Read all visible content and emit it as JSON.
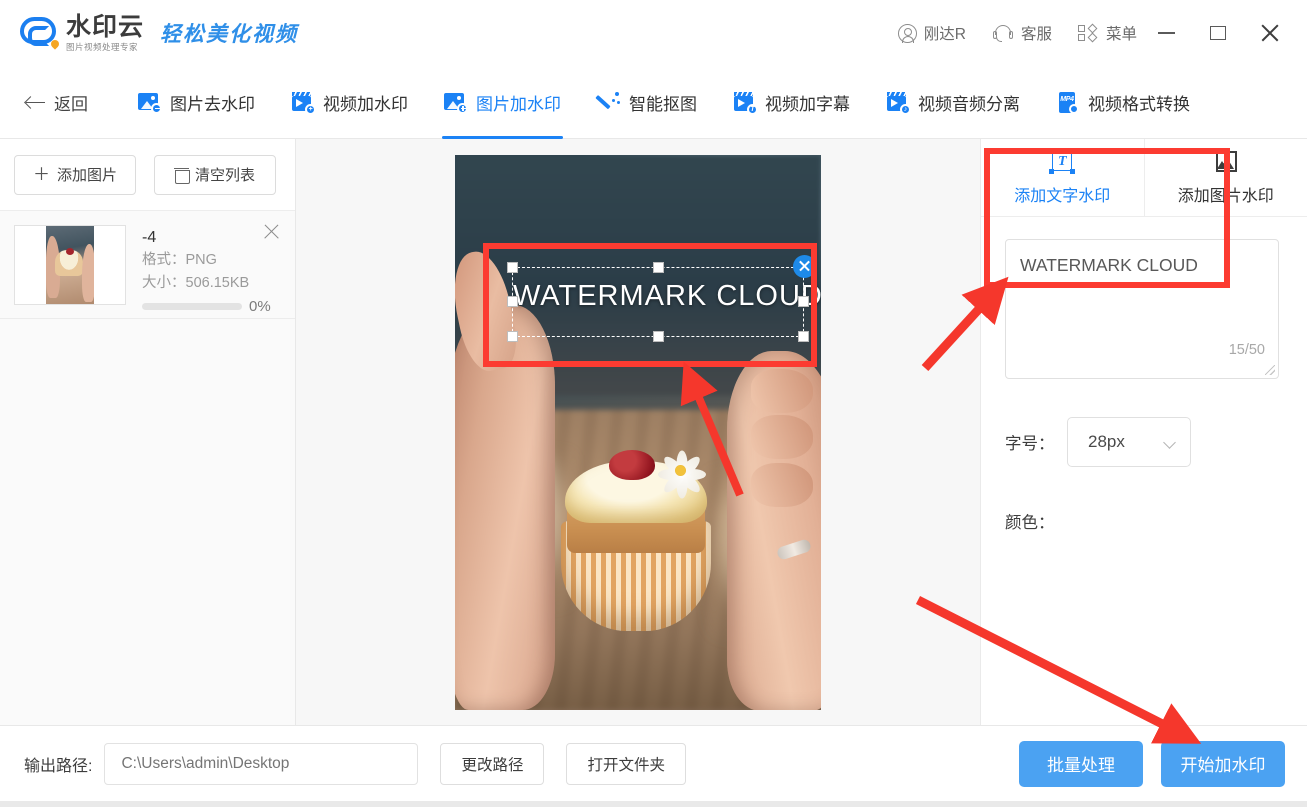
{
  "titlebar": {
    "brand_name": "水印云",
    "brand_sub": "图片视频处理专家",
    "slogan": "轻松美化视频",
    "account": "刚达R",
    "support": "客服",
    "menu": "菜单",
    "minimize_icon": "minimize-icon",
    "maximize_icon": "maximize-icon",
    "close_icon": "close-icon"
  },
  "nav": {
    "back_label": "返回",
    "tabs": [
      {
        "label": "图片去水印",
        "icon": "image-remove-watermark-icon",
        "active": false
      },
      {
        "label": "视频加水印",
        "icon": "video-add-watermark-icon",
        "active": false
      },
      {
        "label": "图片加水印",
        "icon": "image-add-watermark-icon",
        "active": true
      },
      {
        "label": "智能抠图",
        "icon": "magic-wand-icon",
        "active": false
      },
      {
        "label": "视频加字幕",
        "icon": "video-subtitle-icon",
        "active": false
      },
      {
        "label": "视频音频分离",
        "icon": "video-audio-split-icon",
        "active": false
      },
      {
        "label": "视频格式转换",
        "icon": "mp4-convert-icon",
        "active": false
      }
    ]
  },
  "left_panel": {
    "add_images_label": "添加图片",
    "clear_list_label": "清空列表",
    "file": {
      "name": "-4",
      "format_label": "格式：",
      "format_value": "PNG",
      "size_label": "大小：",
      "size_value": "506.15KB",
      "progress_text": "0%",
      "progress_percent": 0
    }
  },
  "canvas": {
    "watermark_text": "WATERMARK CLOUD",
    "watermark_font_size_px": 28,
    "watermark_color": "#ffffff"
  },
  "right_panel": {
    "tabs": [
      {
        "label": "添加文字水印",
        "icon": "text-watermark-icon",
        "active": true
      },
      {
        "label": "添加图片水印",
        "icon": "image-watermark-icon",
        "active": false
      }
    ],
    "textarea_value": "WATERMARK CLOUD",
    "char_counter": "15/50",
    "font_size_label": "字号：",
    "font_size_value": "28px",
    "color_label": "颜色："
  },
  "bottom_bar": {
    "output_label": "输出路径:",
    "output_path": "C:\\Users\\admin\\Desktop",
    "change_path_label": "更改路径",
    "open_folder_label": "打开文件夹",
    "batch_label": "批量处理",
    "start_label": "开始加水印"
  },
  "colors": {
    "accent_blue": "#1b82f5",
    "button_blue": "#4ba2f2",
    "annotation_red": "#fc3b31"
  }
}
